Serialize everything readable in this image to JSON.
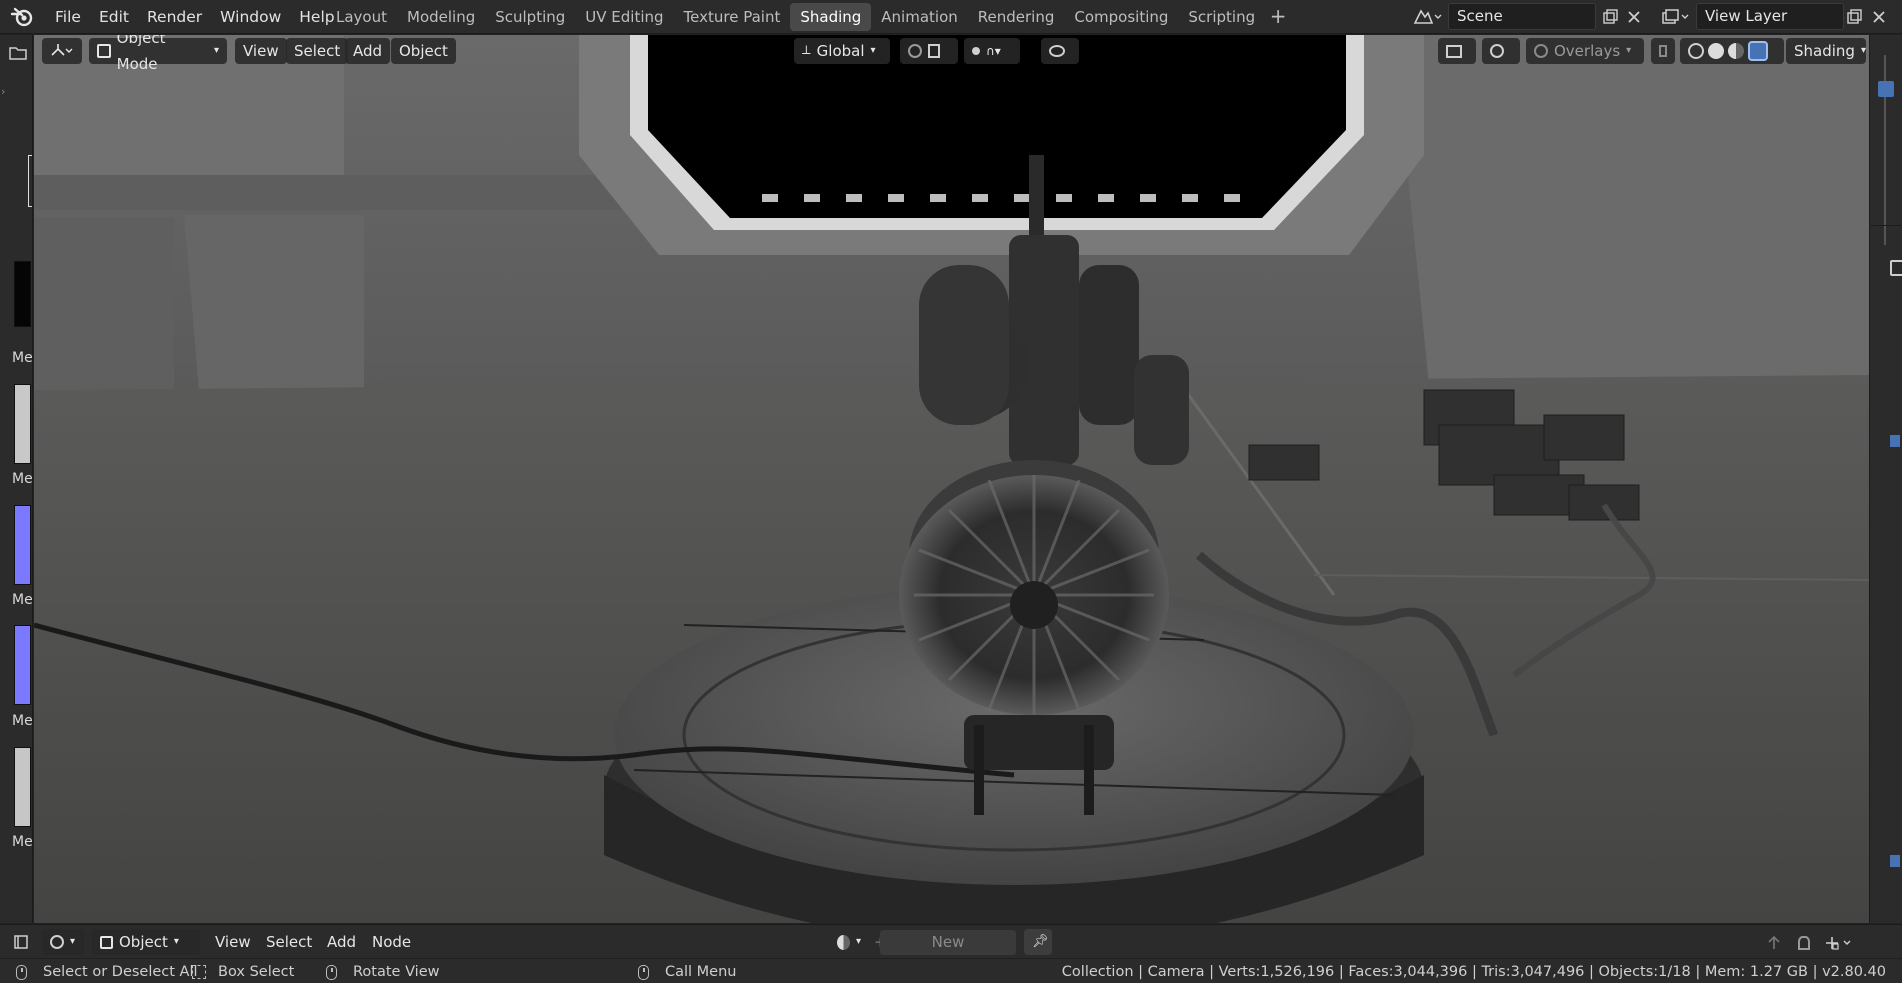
{
  "menu": [
    "File",
    "Edit",
    "Render",
    "Window",
    "Help"
  ],
  "workspaces": [
    {
      "label": "Layout",
      "active": false
    },
    {
      "label": "Modeling",
      "active": false
    },
    {
      "label": "Sculpting",
      "active": false
    },
    {
      "label": "UV Editing",
      "active": false
    },
    {
      "label": "Texture Paint",
      "active": false
    },
    {
      "label": "Shading",
      "active": true
    },
    {
      "label": "Animation",
      "active": false
    },
    {
      "label": "Rendering",
      "active": false
    },
    {
      "label": "Compositing",
      "active": false
    },
    {
      "label": "Scripting",
      "active": false
    }
  ],
  "workspace_add": "+",
  "scene": {
    "name": "Scene"
  },
  "view_layer": {
    "name": "View Layer"
  },
  "viewport_header": {
    "mode": "Object Mode",
    "view": "View",
    "select": "Select",
    "add": "Add",
    "object": "Object",
    "orientation": "Global",
    "overlays": "Overlays",
    "shading": "Shading"
  },
  "left_panel": {
    "material_labels": [
      "Me",
      "Me",
      "Me",
      "Me",
      "Me"
    ],
    "swatch_colors": [
      "#050505",
      "#c8c8c8",
      "#7a79ff",
      "#7a79ff",
      "#c6c6c6"
    ]
  },
  "node_header": {
    "editor": "Object",
    "view": "View",
    "select": "Select",
    "add": "Add",
    "node": "Node",
    "new_label": "New",
    "new_plus": "+"
  },
  "status": {
    "select_all": "Select or Deselect All",
    "box_select": "Box Select",
    "rotate_view": "Rotate View",
    "call_menu": "Call Menu",
    "stats": "Collection | Camera | Verts:1,526,196 | Faces:3,044,396 | Tris:3,047,496 | Objects:1/18 | Mem: 1.27 GB | v2.80.40"
  },
  "colors": {
    "ui_bg": "#2b2b2b",
    "active_tab": "#494949",
    "accent_blue": "#4772b3"
  }
}
